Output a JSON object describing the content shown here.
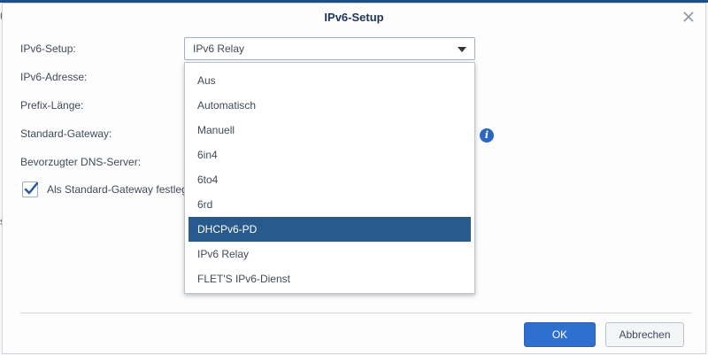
{
  "dialog": {
    "title": "IPv6-Setup",
    "form": {
      "ipv6_setup_label": "IPv6-Setup:",
      "ipv6_setup_value": "IPv6 Relay",
      "ipv6_address_label": "IPv6-Adresse:",
      "prefix_length_label": "Prefix-Länge:",
      "default_gateway_label": "Standard-Gateway:",
      "dns_label": "Bevorzugter DNS-Server:",
      "default_gateway_checkbox_label": "Als Standard-Gateway festlegen",
      "default_gateway_checked": true
    },
    "dropdown": {
      "options": [
        "Aus",
        "Automatisch",
        "Manuell",
        "6in4",
        "6to4",
        "6rd",
        "DHCPv6-PD",
        "IPv6 Relay",
        "FLET'S IPv6-Dienst"
      ],
      "highlighted": "DHCPv6-PD"
    },
    "buttons": {
      "ok": "OK",
      "cancel": "Abbrechen"
    },
    "info_glyph": "i"
  },
  "background": {
    "fragment_1": "(",
    "fragment_2": "s"
  },
  "colors": {
    "accent": "#2f6fd0",
    "highlight": "#295a8d",
    "title": "#1d3557"
  }
}
